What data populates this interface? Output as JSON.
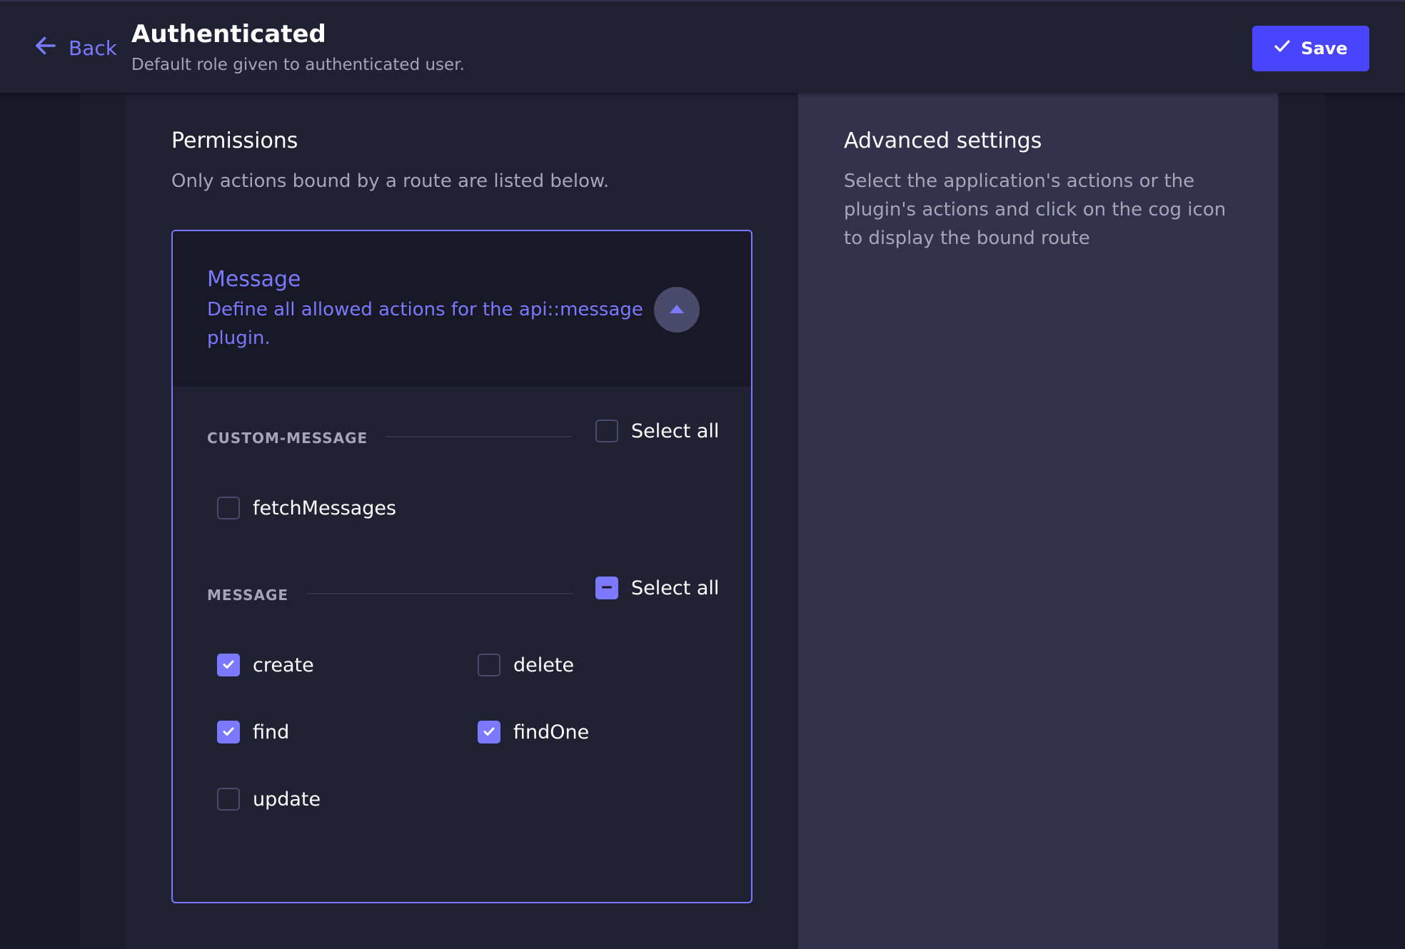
{
  "header": {
    "back_label": "Back",
    "title": "Authenticated",
    "subtitle": "Default role given to authenticated user.",
    "save_label": "Save"
  },
  "permissions": {
    "title": "Permissions",
    "description": "Only actions bound by a route are listed below.",
    "accordion": {
      "title": "Message",
      "description": "Define all allowed actions for the api::message plugin.",
      "expanded": true,
      "groups": [
        {
          "label": "CUSTOM-MESSAGE",
          "select_all_label": "Select all",
          "select_all_state": "unchecked",
          "actions": [
            {
              "label": "fetchMessages",
              "checked": false
            }
          ]
        },
        {
          "label": "MESSAGE",
          "select_all_label": "Select all",
          "select_all_state": "indeterminate",
          "actions": [
            {
              "label": "create",
              "checked": true
            },
            {
              "label": "delete",
              "checked": false
            },
            {
              "label": "find",
              "checked": true
            },
            {
              "label": "findOne",
              "checked": true
            },
            {
              "label": "update",
              "checked": false
            }
          ]
        }
      ]
    }
  },
  "advanced": {
    "title": "Advanced settings",
    "description": "Select the application's actions or the plugin's actions and click on the cog icon to display the bound route"
  },
  "colors": {
    "accent": "#7b79ff",
    "primary_button": "#4945ff",
    "background": "#212134",
    "panel": "#32324d"
  },
  "icons": {
    "back": "arrow-left-icon",
    "save": "check-icon",
    "toggle": "caret-up-icon"
  }
}
